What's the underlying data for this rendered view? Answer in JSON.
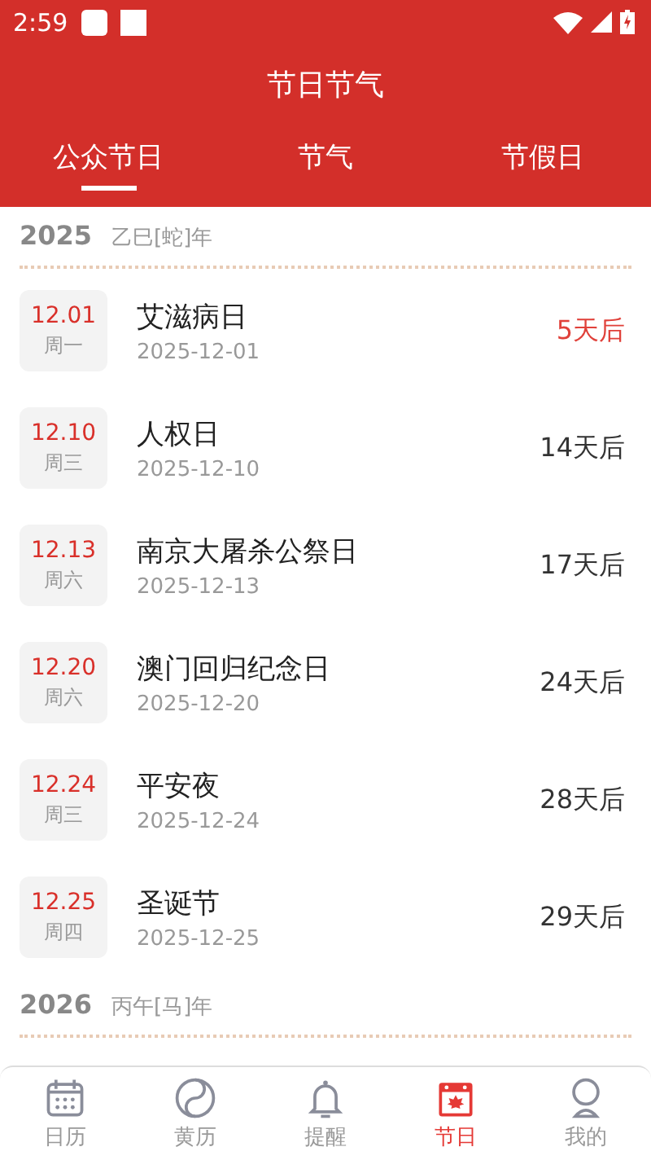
{
  "status_bar": {
    "time": "2:59"
  },
  "header": {
    "title": "节日节气"
  },
  "tabs": [
    {
      "label": "公众节日",
      "selected": true
    },
    {
      "label": "节气",
      "selected": false
    },
    {
      "label": "节假日",
      "selected": false
    }
  ],
  "years": [
    {
      "year": "2025",
      "ganzhi": "乙巳[蛇]年",
      "items": [
        {
          "date": "12.01",
          "weekday": "周一",
          "name": "艾滋病日",
          "full_date": "2025-12-01",
          "countdown": "5天后",
          "soon": true
        },
        {
          "date": "12.10",
          "weekday": "周三",
          "name": "人权日",
          "full_date": "2025-12-10",
          "countdown": "14天后",
          "soon": false
        },
        {
          "date": "12.13",
          "weekday": "周六",
          "name": "南京大屠杀公祭日",
          "full_date": "2025-12-13",
          "countdown": "17天后",
          "soon": false
        },
        {
          "date": "12.20",
          "weekday": "周六",
          "name": "澳门回归纪念日",
          "full_date": "2025-12-20",
          "countdown": "24天后",
          "soon": false
        },
        {
          "date": "12.24",
          "weekday": "周三",
          "name": "平安夜",
          "full_date": "2025-12-24",
          "countdown": "28天后",
          "soon": false
        },
        {
          "date": "12.25",
          "weekday": "周四",
          "name": "圣诞节",
          "full_date": "2025-12-25",
          "countdown": "29天后",
          "soon": false
        }
      ]
    },
    {
      "year": "2026",
      "ganzhi": "丙午[马]年"
    }
  ],
  "bottom_nav": [
    {
      "label": "日历",
      "selected": false
    },
    {
      "label": "黄历",
      "selected": false
    },
    {
      "label": "提醒",
      "selected": false
    },
    {
      "label": "节日",
      "selected": true
    },
    {
      "label": "我的",
      "selected": false
    }
  ]
}
